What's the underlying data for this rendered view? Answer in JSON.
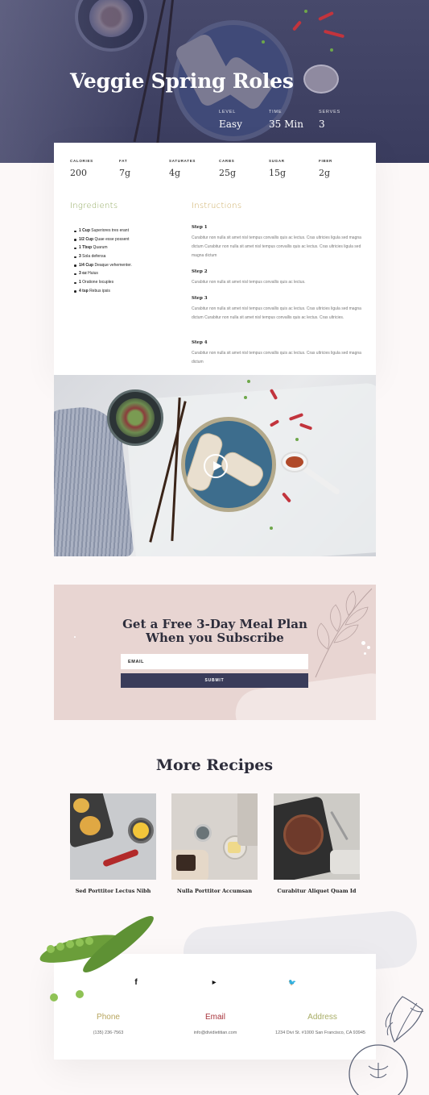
{
  "hero": {
    "title": "Veggie Spring Roles",
    "stats": [
      {
        "label": "LEVEL",
        "value": "Easy"
      },
      {
        "label": "TIME",
        "value": "35 Min"
      },
      {
        "label": "SERVES",
        "value": "3"
      }
    ]
  },
  "nutrition": [
    {
      "label": "CALORIES",
      "value": "200"
    },
    {
      "label": "FAT",
      "value": "7g"
    },
    {
      "label": "SATURATES",
      "value": "4g"
    },
    {
      "label": "CARBS",
      "value": "25g"
    },
    {
      "label": "SUGAR",
      "value": "15g"
    },
    {
      "label": "FIBER",
      "value": "2g"
    }
  ],
  "ingredients": {
    "title": "Ingredients",
    "items": [
      {
        "qty": "1 Cup",
        "text": "Superiores tres erant"
      },
      {
        "qty": "1/2 Cup",
        "text": "Quae esse possent"
      },
      {
        "qty": "1 Tbsp",
        "text": "Quarum"
      },
      {
        "qty": "3",
        "text": "Sola defensa"
      },
      {
        "qty": "1/4 Cup",
        "text": "Deaque vehementer."
      },
      {
        "qty": "3 oz",
        "text": "Huius"
      },
      {
        "qty": "1",
        "text": "Oratione locuples"
      },
      {
        "qty": "4 tsp",
        "text": "Rebus ipsis"
      }
    ]
  },
  "instructions": {
    "title": "Instructions",
    "steps": [
      {
        "title": "Step 1",
        "text": "Curabitur non nulla sit amet nisl tempus convallis quis ac lectus. Cras ultricies ligula sed magna dictum Curabitur non nulla sit amet nisl tempus convallis quis ac lectus. Cras ultricies ligula sed magna dictum"
      },
      {
        "title": "Step 2",
        "text": "Curabitur non nulla sit amet nisl tempus convallis quis ac lectus."
      },
      {
        "title": "Step 3",
        "text": "Curabitur non nulla sit amet nisl tempus convallis quis ac lectus. Cras ultricies ligula sed magna dictum Curabitur non nulla sit amet nisl tempus convallis quis ac lectus. Cras ultricies."
      },
      {
        "title": "Step 4",
        "text": "Curabitur non nulla sit amet nisl tempus convallis quis ac lectus. Cras ultricies ligula sed magna dictum"
      }
    ]
  },
  "video": {
    "play_icon": "play-icon"
  },
  "subscribe": {
    "line1": "Get a Free 3-Day Meal Plan",
    "line2": "When you Subscribe",
    "email_placeholder": "EMAIL",
    "submit_label": "SUBMIT"
  },
  "more": {
    "title": "More Recipes",
    "recipes": [
      {
        "title": "Sed Porttitor Lectus Nibh"
      },
      {
        "title": "Nulla Porttitor Accumsan"
      },
      {
        "title": "Curabitur Aliquet Quam Id"
      }
    ]
  },
  "footer": {
    "social": [
      {
        "icon": "facebook-icon",
        "glyph": "f"
      },
      {
        "icon": "youtube-icon",
        "glyph": "▶"
      },
      {
        "icon": "twitter-icon",
        "glyph": "🐦"
      }
    ],
    "contacts": [
      {
        "title": "Phone",
        "value": "(135) 236-7563",
        "color": "#b7a55e"
      },
      {
        "title": "Email",
        "value": "info@dividietitian.com",
        "color": "#a8343c"
      },
      {
        "title": "Address",
        "value": "1234 Divi St. #1000 San Francisco, CA 93945",
        "color": "#a8ad66"
      }
    ]
  },
  "colors": {
    "accent_gold": "#c9a85a",
    "accent_green": "#8ea75b",
    "navy": "#3a3c5a",
    "pink": "#e8d5d2"
  }
}
